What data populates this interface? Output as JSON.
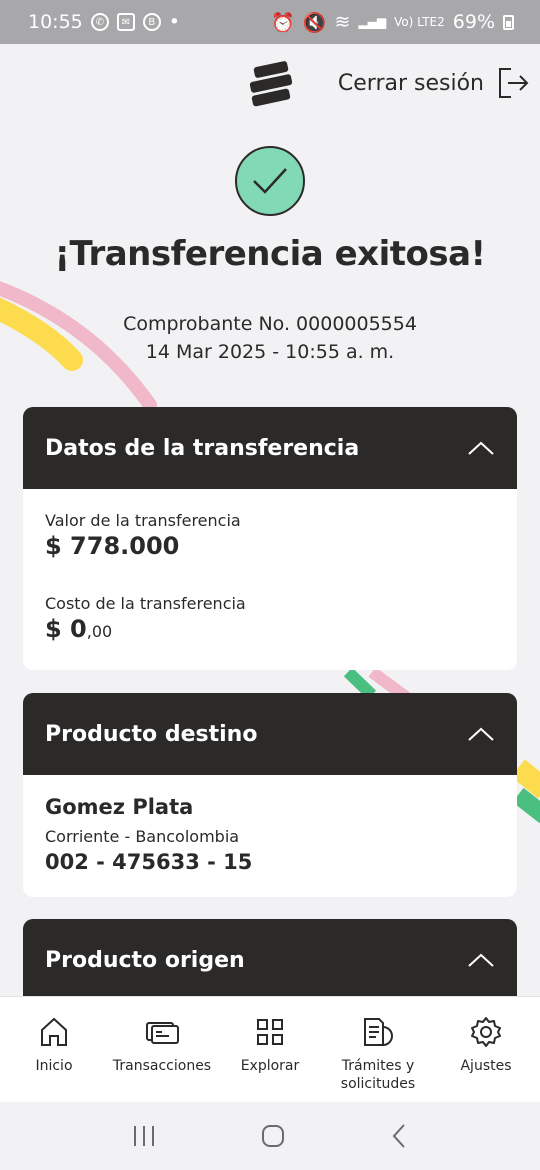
{
  "status_bar": {
    "time": "10:55",
    "network_vo": "Vo) LTE2",
    "battery": "69%"
  },
  "header": {
    "logout_label": "Cerrar sesión"
  },
  "result": {
    "title": "¡Transferencia exitosa!",
    "receipt_line": "Comprobante No. 0000005554",
    "datetime_line": "14 Mar 2025 - 10:55 a. m."
  },
  "transfer_card": {
    "title": "Datos de la transferencia",
    "value_label": "Valor de la transferencia",
    "value": "$ 778.000",
    "cost_label": "Costo de la transferencia",
    "cost_main": "$ 0",
    "cost_cents": ",00"
  },
  "destination_card": {
    "title": "Producto destino",
    "name": "Gomez Plata",
    "type": "Corriente - Bancolombia",
    "number": "002 - 475633 - 15"
  },
  "origin_card": {
    "title": "Producto origen"
  },
  "bottom_nav": {
    "items": [
      {
        "label": "Inicio",
        "icon": "home-icon"
      },
      {
        "label": "Transacciones",
        "icon": "transactions-icon"
      },
      {
        "label": "Explorar",
        "icon": "grid-icon"
      },
      {
        "label": "Trámites y solicitudes",
        "icon": "documents-icon"
      },
      {
        "label": "Ajustes",
        "icon": "gear-icon"
      }
    ]
  },
  "colors": {
    "dark": "#2c2a29",
    "success_green": "#82d9b5",
    "accent_yellow": "#fddb4e",
    "accent_pink": "#f0b8c9",
    "accent_green": "#4bbf7f"
  }
}
